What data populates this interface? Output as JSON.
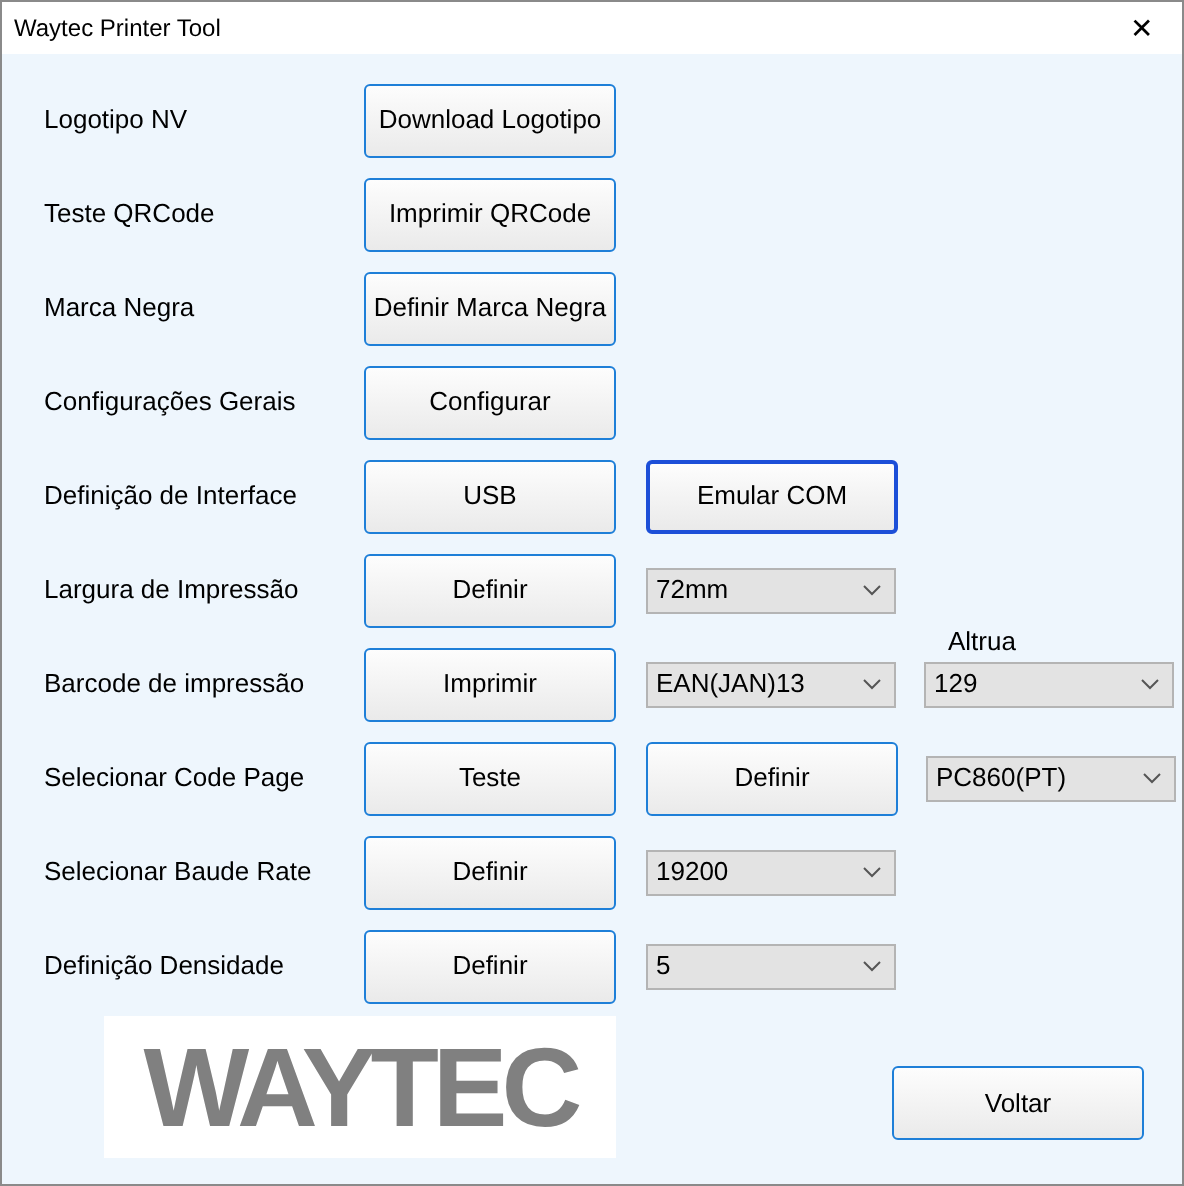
{
  "window": {
    "title": "Waytec Printer Tool",
    "close": "✕"
  },
  "rows": [
    {
      "label": "Logotipo NV",
      "controls": [
        {
          "kind": "button",
          "text": "Download Logotipo",
          "focused": false
        }
      ]
    },
    {
      "label": "Teste QRCode",
      "controls": [
        {
          "kind": "button",
          "text": "Imprimir QRCode",
          "focused": false
        }
      ]
    },
    {
      "label": "Marca Negra",
      "controls": [
        {
          "kind": "button",
          "text": "Definir Marca Negra",
          "focused": false
        }
      ]
    },
    {
      "label": "Configurações Gerais",
      "controls": [
        {
          "kind": "button",
          "text": "Configurar",
          "focused": false
        }
      ]
    },
    {
      "label": "Definição de Interface",
      "controls": [
        {
          "kind": "button",
          "text": "USB",
          "focused": false
        },
        {
          "kind": "button",
          "text": "Emular COM",
          "focused": true
        }
      ]
    },
    {
      "label": "Largura de Impressão",
      "controls": [
        {
          "kind": "button",
          "text": "Definir",
          "focused": false
        },
        {
          "kind": "combo",
          "value": "72mm"
        }
      ]
    },
    {
      "label": "Barcode de impressão",
      "controls": [
        {
          "kind": "button",
          "text": "Imprimir",
          "focused": false
        },
        {
          "kind": "combo",
          "value": "EAN(JAN)13"
        },
        {
          "kind": "combo",
          "value": "129",
          "caption": "Altrua"
        }
      ]
    },
    {
      "label": "Selecionar Code Page",
      "controls": [
        {
          "kind": "button",
          "text": "Teste",
          "focused": false
        },
        {
          "kind": "button",
          "text": "Definir",
          "focused": false
        },
        {
          "kind": "combo",
          "value": "PC860(PT)"
        }
      ]
    },
    {
      "label": "Selecionar Baude Rate",
      "controls": [
        {
          "kind": "button",
          "text": "Definir",
          "focused": false
        },
        {
          "kind": "combo",
          "value": "19200"
        }
      ]
    },
    {
      "label": "Definição Densidade",
      "controls": [
        {
          "kind": "button",
          "text": "Definir",
          "focused": false
        },
        {
          "kind": "combo",
          "value": "5"
        }
      ]
    }
  ],
  "logo": {
    "text": "WAYTEC"
  },
  "back_button": "Voltar"
}
